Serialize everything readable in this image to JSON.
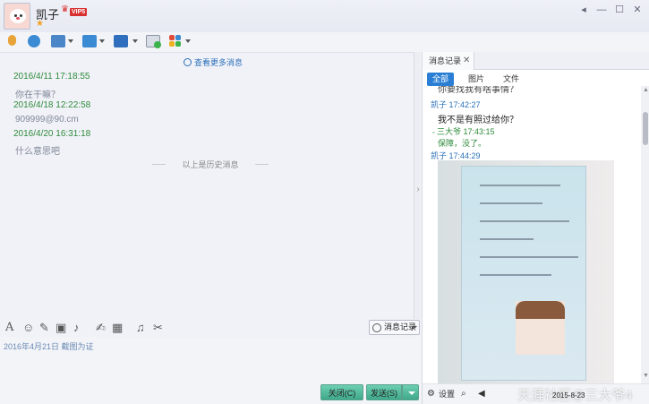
{
  "window": {
    "contact_name": "凯子",
    "vip_label": "VIP5",
    "minimize_glyph": "◂",
    "restore_glyph": "—",
    "maximize_glyph": "☐",
    "close_glyph": "✕"
  },
  "toolbar": {
    "icons": [
      "microphone-icon",
      "camera-icon",
      "screen-share-icon",
      "folder-transfer-icon",
      "remote-desktop-icon",
      "add-contact-icon",
      "apps-grid-icon"
    ]
  },
  "chat": {
    "more_messages_link": "查看更多消息",
    "messages": [
      {
        "time": "2016/4/11 17:18:55",
        "text": "你在干嘛？"
      },
      {
        "time": "2016/4/18 12:22:58",
        "text": "909999@90.cm"
      },
      {
        "time": "2016/4/20 16:31:18",
        "text": "什么意思吧"
      }
    ],
    "history_divider": "以上是历史消息"
  },
  "input": {
    "history_button_label": "消息记录",
    "draft_text": "2016年4月21日 截图为证",
    "close_button_label": "关闭(C)",
    "send_button_label": "发送(S)",
    "tool_icons": [
      "font-icon",
      "emoji-icon",
      "shake-icon",
      "screenshot-icon",
      "voice-message-icon",
      "edit-icon",
      "image-icon",
      "music-icon",
      "scissors-icon"
    ]
  },
  "history_panel": {
    "tab_label": "消息记录",
    "tab_close": "✕",
    "filters": [
      "全部",
      "图片",
      "文件"
    ],
    "active_filter": "全部",
    "partial_line": "你要找我有啥事情？",
    "entries": [
      {
        "sender_time": "凯子 17:42:27",
        "text": "我不是有照过给你？"
      },
      {
        "sender_time": "三大爷 17:43:15",
        "text": "保障，没了。"
      },
      {
        "sender_time": "凯子 17:44:29",
        "text": ""
      }
    ],
    "footer_settings": "设置",
    "footer_date": "2015-8-23",
    "watermark": "天涯社区@三大爷4"
  },
  "colors": {
    "accent": "#2a7fd4",
    "sender_blue": "#2a6fb8",
    "timestamp_green": "#2e8b3a",
    "button_green": "#3fa88a",
    "vip_red": "#d83030"
  }
}
